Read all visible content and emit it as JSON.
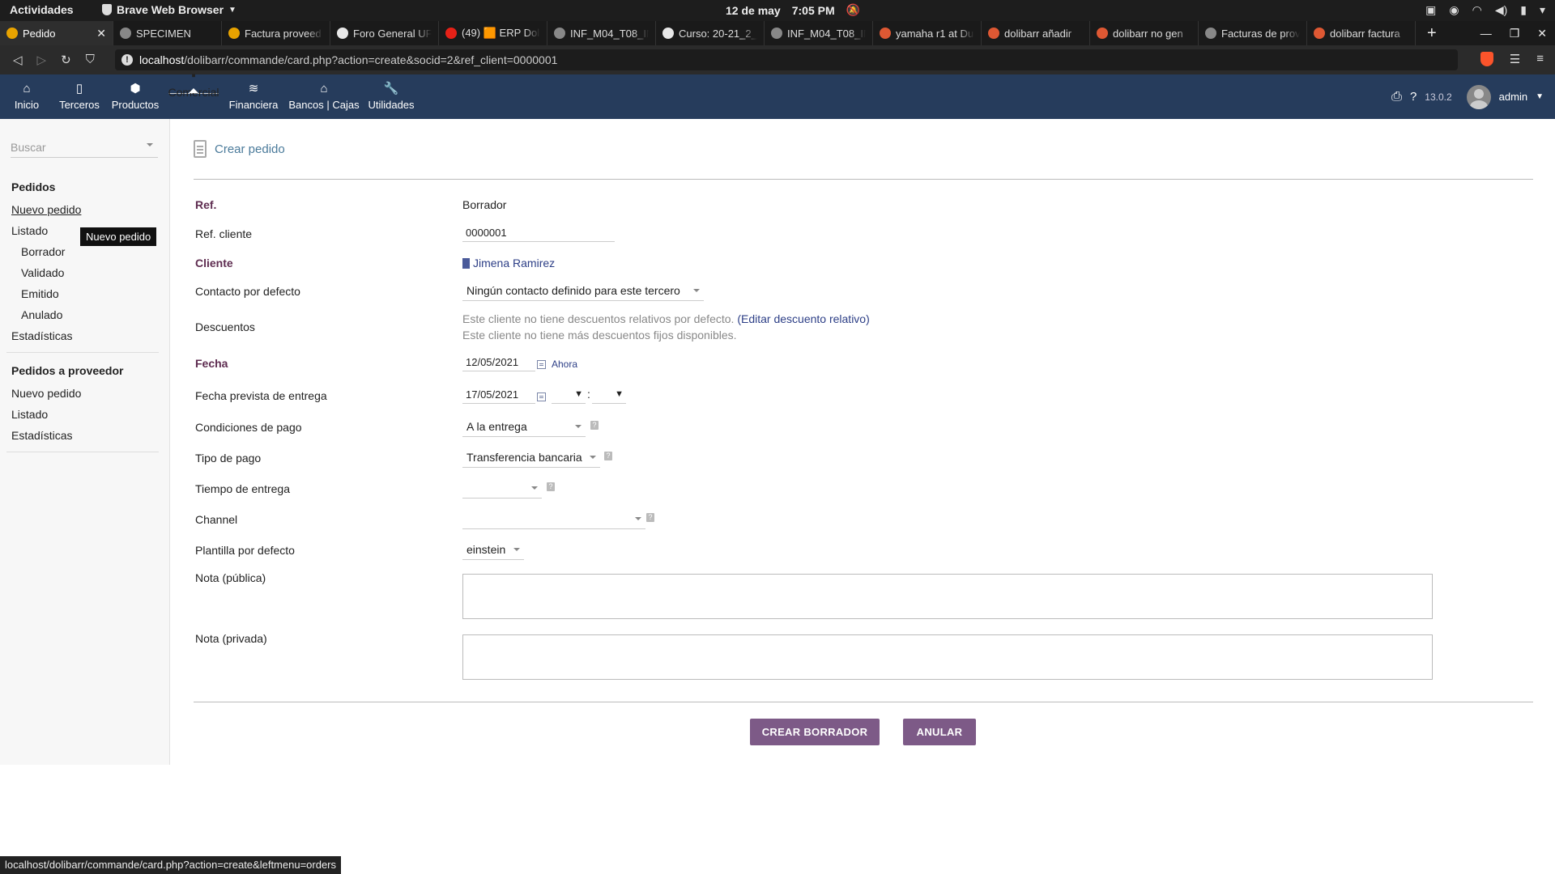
{
  "gnome": {
    "activities": "Actividades",
    "app_name": "Brave Web Browser",
    "date": "12 de may",
    "time": "7:05 PM"
  },
  "tabs": [
    {
      "title": "Pedido",
      "favicon_color": "#e8a300",
      "active": true
    },
    {
      "title": "SPECIMEN",
      "favicon_color": "#888888"
    },
    {
      "title": "Factura proveed",
      "favicon_color": "#e8a300"
    },
    {
      "title": "Foro General UF",
      "favicon_color": "#e8e8e8"
    },
    {
      "title": "(49) 🟧 ERP Doli",
      "favicon_color": "#e62117"
    },
    {
      "title": "INF_M04_T08_IN",
      "favicon_color": "#888888"
    },
    {
      "title": "Curso: 20-21_2_D",
      "favicon_color": "#e8e8e8"
    },
    {
      "title": "INF_M04_T08_IN",
      "favicon_color": "#888888"
    },
    {
      "title": "yamaha r1 at Du",
      "favicon_color": "#de5833"
    },
    {
      "title": "dolibarr añadir",
      "favicon_color": "#de5833"
    },
    {
      "title": "dolibarr no gen",
      "favicon_color": "#de5833"
    },
    {
      "title": "Facturas de prov",
      "favicon_color": "#888888"
    },
    {
      "title": "dolibarr factura",
      "favicon_color": "#de5833"
    }
  ],
  "address": {
    "host": "localhost",
    "path": "/dolibarr/commande/card.php?action=create&socid=2&ref_client=0000001"
  },
  "topmenu": {
    "items": [
      {
        "label": "Inicio",
        "icon": "home-icon"
      },
      {
        "label": "Terceros",
        "icon": "building-icon"
      },
      {
        "label": "Productos",
        "icon": "cube-icon"
      },
      {
        "label": "Comercial",
        "icon": "briefcase-icon",
        "selected": true
      },
      {
        "label": "Financiera",
        "icon": "coins-icon"
      },
      {
        "label": "Bancos | Cajas",
        "icon": "bank-icon"
      },
      {
        "label": "Utilidades",
        "icon": "wrench-icon"
      }
    ],
    "version": "13.0.2",
    "user": "admin"
  },
  "leftmenu": {
    "search_placeholder": "Buscar",
    "section1_title": "Pedidos",
    "new_order": "Nuevo pedido",
    "list": "Listado",
    "draft": "Borrador",
    "validated": "Validado",
    "sent": "Emitido",
    "cancelled": "Anulado",
    "stats": "Estadísticas",
    "section2_title": "Pedidos a proveedor",
    "supplier_new": "Nuevo pedido",
    "supplier_list": "Listado",
    "supplier_stats": "Estadísticas",
    "tooltip": "Nuevo pedido"
  },
  "form": {
    "page_title": "Crear pedido",
    "ref_label": "Ref.",
    "ref_value": "Borrador",
    "ref_client_label": "Ref. cliente",
    "ref_client_value": "0000001",
    "client_label": "Cliente",
    "client_value": "Jimena Ramirez",
    "contact_label": "Contacto por defecto",
    "contact_value": "Ningún contacto definido para este tercero",
    "discounts_label": "Descuentos",
    "discount_line1": "Este cliente no tiene descuentos relativos por defecto.",
    "discount_link": "Editar descuento relativo",
    "discount_line2": "Este cliente no tiene más descuentos fijos disponibles.",
    "date_label": "Fecha",
    "date_value": "12/05/2021",
    "now_link": "Ahora",
    "delivery_date_label": "Fecha prevista de entrega",
    "delivery_date_value": "17/05/2021",
    "payment_terms_label": "Condiciones de pago",
    "payment_terms_value": "A la entrega",
    "payment_type_label": "Tipo de pago",
    "payment_type_value": "Transferencia bancaria",
    "delivery_time_label": "Tiempo de entrega",
    "channel_label": "Channel",
    "template_label": "Plantilla por defecto",
    "template_value": "einstein",
    "note_public_label": "Nota (pública)",
    "note_private_label": "Nota (privada)",
    "create_button": "CREAR BORRADOR",
    "cancel_button": "ANULAR"
  },
  "statusbar": "localhost/dolibarr/commande/card.php?action=create&leftmenu=orders"
}
